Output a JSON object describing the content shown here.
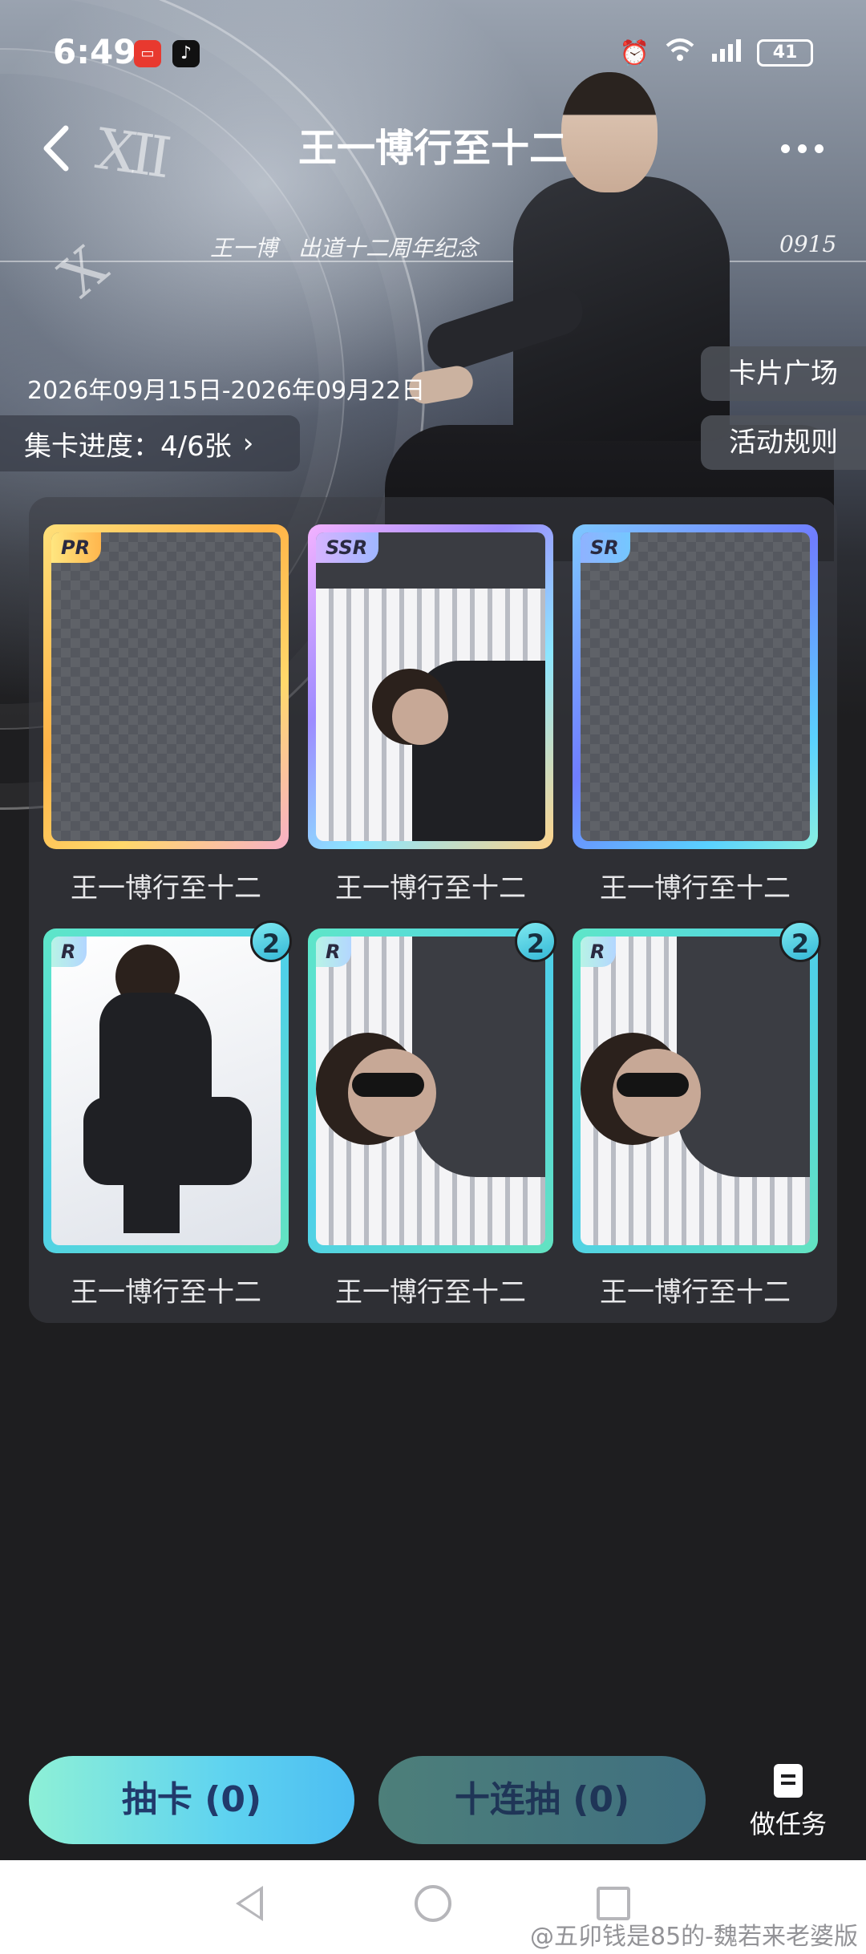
{
  "status_bar": {
    "time": "6:49",
    "app_icons": [
      "xiaohongshu-icon",
      "tiktok-icon"
    ],
    "right_icons": [
      "alarm-icon",
      "wifi-icon",
      "signal-icon"
    ],
    "battery": "41"
  },
  "header": {
    "title": "王一博行至十二",
    "artist_line": "王一博",
    "anniversary_line": "出道十二周年纪念",
    "date_code": "0915",
    "numerals": [
      "XII",
      "X"
    ]
  },
  "event": {
    "date_range": "2026年09月15日-2026年09月22日",
    "progress_label": "集卡进度：4/6张",
    "progress_value": 0.6667
  },
  "side_buttons": {
    "card_plaza": "卡片广场",
    "rules": "活动规则"
  },
  "cards": [
    {
      "rarity": "PR",
      "name": "王一博行至十二",
      "collected": false,
      "count": ""
    },
    {
      "rarity": "SSR",
      "name": "王一博行至十二",
      "collected": true,
      "count": ""
    },
    {
      "rarity": "SR",
      "name": "王一博行至十二",
      "collected": false,
      "count": ""
    },
    {
      "rarity": "R",
      "name": "王一博行至十二",
      "collected": true,
      "count": "2"
    },
    {
      "rarity": "R",
      "name": "王一博行至十二",
      "collected": true,
      "count": "2"
    },
    {
      "rarity": "R",
      "name": "王一博行至十二",
      "collected": true,
      "count": "2"
    }
  ],
  "actions": {
    "draw": "抽卡 (0)",
    "draw_ten": "十连抽 (0)",
    "tasks": "做任务"
  },
  "watermark": "@五卯钱是85的-魏若来老婆版",
  "colors": {
    "background": "#1e1e20",
    "draw_gradient_start": "#8ef0d6",
    "draw_gradient_end": "#4cbdf2",
    "draw_ten": "#4d7f7a",
    "badge": "#33b8d6"
  }
}
